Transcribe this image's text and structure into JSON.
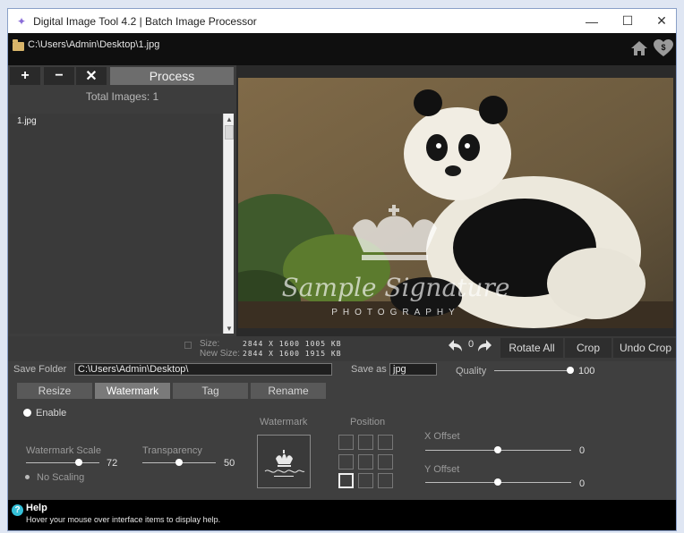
{
  "window": {
    "title": "Digital Image Tool 4.2  |  Batch Image Processor",
    "minimize": "—",
    "maximize": "☐",
    "close": "✕"
  },
  "pathbar": {
    "path": "C:\\Users\\Admin\\Desktop\\1.jpg"
  },
  "toolbar": {
    "add": "+",
    "remove": "−",
    "clear": "✕",
    "process": "Process"
  },
  "filelist": {
    "total": "Total Images: 1",
    "items": [
      "1.jpg"
    ]
  },
  "watermark_preview": {
    "signature": "Sample Signature",
    "subtitle": "PHOTOGRAPHY"
  },
  "info": {
    "size_label": "Size:",
    "new_size_label": "New Size:",
    "size_value": "2844 X 1600  1005 KB",
    "new_size_value": "2844 X 1600  1915 KB",
    "rotation": "0"
  },
  "actions": {
    "rotate_all": "Rotate All",
    "crop": "Crop",
    "undo_crop": "Undo Crop"
  },
  "save": {
    "folder_label": "Save Folder",
    "folder_value": "C:\\Users\\Admin\\Desktop\\",
    "as_label": "Save as",
    "as_value": "jpg",
    "quality_label": "Quality",
    "quality_value": "100",
    "quality_fraction": 1.0
  },
  "tabs": [
    "Resize",
    "Watermark",
    "Tag",
    "Rename"
  ],
  "active_tab": "Watermark",
  "watermark_tab": {
    "enable_label": "Enable",
    "watermark_label": "Watermark",
    "position_label": "Position",
    "scale_label": "Watermark Scale",
    "scale_value": "72",
    "scale_fraction": 0.72,
    "transparency_label": "Transparency",
    "transparency_value": "50",
    "transparency_fraction": 0.5,
    "no_scaling_label": "No Scaling",
    "x_offset_label": "X Offset",
    "x_offset_value": "0",
    "y_offset_label": "Y Offset",
    "y_offset_value": "0",
    "selected_position": "bottom-left"
  },
  "help": {
    "title": "Help",
    "text": "Hover your mouse over interface items to display help."
  },
  "icons": [
    "app-icon",
    "folder-icon",
    "home-icon",
    "donate-icon",
    "rotate-left-icon",
    "rotate-right-icon",
    "help-icon"
  ]
}
